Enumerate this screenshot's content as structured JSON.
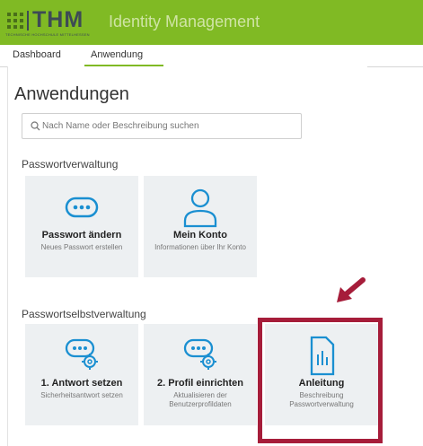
{
  "header": {
    "logo_text": "THM",
    "logo_subtext": "TECHNISCHE HOCHSCHULE MITTELHESSEN",
    "app_title": "Identity Management",
    "brand_color": "#80ba24"
  },
  "tabs": [
    {
      "label": "Dashboard",
      "active": false
    },
    {
      "label": "Anwendung",
      "active": true
    }
  ],
  "main": {
    "title": "Anwendungen",
    "search": {
      "placeholder": "Nach Name oder Beschreibung suchen",
      "value": ""
    }
  },
  "sections": [
    {
      "title": "Passwortverwaltung",
      "tiles": [
        {
          "title": "Passwort ändern",
          "subtitle": "Neues Passwort erstellen",
          "icon": "password-dots-icon"
        },
        {
          "title": "Mein Konto",
          "subtitle": "Informationen über Ihr Konto",
          "icon": "user-icon"
        }
      ]
    },
    {
      "title": "Passwortselbstverwaltung",
      "tiles": [
        {
          "title": "1. Antwort setzen",
          "subtitle": "Sicherheitsantwort setzen",
          "icon": "password-gear-icon"
        },
        {
          "title": "2. Profil einrichten",
          "subtitle": "Aktualisieren der Benutzerprofildaten",
          "icon": "password-gear-icon"
        },
        {
          "title": "Anleitung",
          "subtitle": "Beschreibung Passwortverwaltung",
          "icon": "document-chart-icon"
        }
      ]
    }
  ],
  "annotation": {
    "highlight_color": "#a61d3a",
    "arrow": "arrow-down-left-icon"
  }
}
